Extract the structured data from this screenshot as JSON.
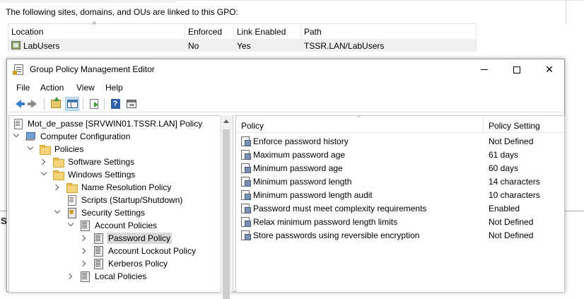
{
  "background": {
    "caption": "The following sites, domains, and OUs are linked to this GPO:",
    "link_table": {
      "columns": [
        "Location",
        "Enforced",
        "Link Enabled",
        "Path"
      ],
      "rows": [
        {
          "location": "LabUsers",
          "enforced": "No",
          "link_enabled": "Yes",
          "path": "TSSR.LAN/LabUsers"
        }
      ]
    },
    "partial_char": "S"
  },
  "window": {
    "title": "Group Policy Management Editor",
    "controls": {
      "minimize": "—",
      "maximize": "☐",
      "close": "✕"
    },
    "menu": [
      "File",
      "Action",
      "View",
      "Help"
    ],
    "toolbar": [
      "back-icon",
      "forward-icon",
      "up-folder-icon",
      "show-hide-tree-icon",
      "export-list-icon",
      "help-icon",
      "properties-icon"
    ]
  },
  "tree": {
    "items": [
      {
        "label": "Mot_de_passe [SRVWIN01.TSSR.LAN] Policy",
        "icon": "policy-doc-icon"
      },
      {
        "label": "Computer Configuration",
        "icon": "computer-icon",
        "expanded": true
      },
      {
        "label": "Policies",
        "icon": "folder-icon",
        "expanded": true
      },
      {
        "label": "Software Settings",
        "icon": "folder-icon",
        "expanded": false
      },
      {
        "label": "Windows Settings",
        "icon": "folder-icon",
        "expanded": true
      },
      {
        "label": "Name Resolution Policy",
        "icon": "folder-icon",
        "expanded": false
      },
      {
        "label": "Scripts (Startup/Shutdown)",
        "icon": "script-doc-icon"
      },
      {
        "label": "Security Settings",
        "icon": "security-icon",
        "expanded": true
      },
      {
        "label": "Account Policies",
        "icon": "policy-folder-icon",
        "expanded": true
      },
      {
        "label": "Password Policy",
        "icon": "policy-folder-icon",
        "expanded": false,
        "selected": true
      },
      {
        "label": "Account Lockout Policy",
        "icon": "policy-folder-icon",
        "expanded": false
      },
      {
        "label": "Kerberos Policy",
        "icon": "policy-folder-icon",
        "expanded": false
      },
      {
        "label": "Local Policies",
        "icon": "policy-folder-icon",
        "expanded": false
      }
    ]
  },
  "list": {
    "columns": {
      "policy": "Policy",
      "setting": "Policy Setting"
    },
    "rows": [
      {
        "policy": "Enforce password history",
        "setting": "Not Defined"
      },
      {
        "policy": "Maximum password age",
        "setting": "61 days"
      },
      {
        "policy": "Minimum password age",
        "setting": "60 days"
      },
      {
        "policy": "Minimum password length",
        "setting": "14 characters"
      },
      {
        "policy": "Minimum password length audit",
        "setting": "10 characters"
      },
      {
        "policy": "Password must meet complexity requirements",
        "setting": "Enabled"
      },
      {
        "policy": "Relax minimum password length limits",
        "setting": "Not Defined"
      },
      {
        "policy": "Store passwords using reversible encryption",
        "setting": "Not Defined"
      }
    ]
  }
}
